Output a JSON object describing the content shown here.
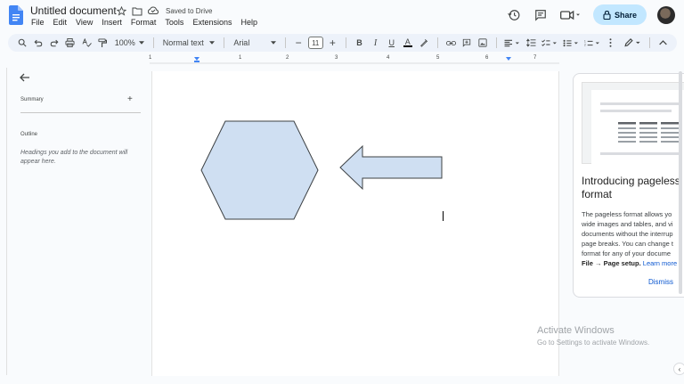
{
  "title_bar": {
    "document_title": "Untitled document",
    "saved_status": "Saved to Drive",
    "share_label": "Share"
  },
  "menu": {
    "items": [
      "File",
      "Edit",
      "View",
      "Insert",
      "Format",
      "Tools",
      "Extensions",
      "Help"
    ]
  },
  "toolbar": {
    "zoom": "100%",
    "style": "Normal text",
    "font": "Arial",
    "font_size": "11"
  },
  "ruler": {
    "numbers": [
      "1",
      "1",
      "2",
      "3",
      "4",
      "5",
      "6",
      "7"
    ]
  },
  "sidebar": {
    "summary_label": "Summary",
    "add_label": "+",
    "outline_label": "Outline",
    "outline_hint": "Headings you add to the document will appear here."
  },
  "promo": {
    "title": "Introducing pageless format",
    "body_line1": "The pageless format allows yo",
    "body_line2": "wide images and tables, and vi",
    "body_line3": "documents without the interrup",
    "body_line4": "page breaks. You can change t",
    "body_line5": "format for any of your docume",
    "body_bold": "File → Page setup.",
    "learn_more": "Learn more",
    "dismiss": "Dismiss"
  },
  "watermark": {
    "line1": "Activate Windows",
    "line2": "Go to Settings to activate Windows."
  },
  "colors": {
    "shape_fill": "#cfdff2",
    "shape_stroke": "#3c4043",
    "share_bg": "#c2e7ff",
    "toolbar_bg": "#edf2fa"
  }
}
